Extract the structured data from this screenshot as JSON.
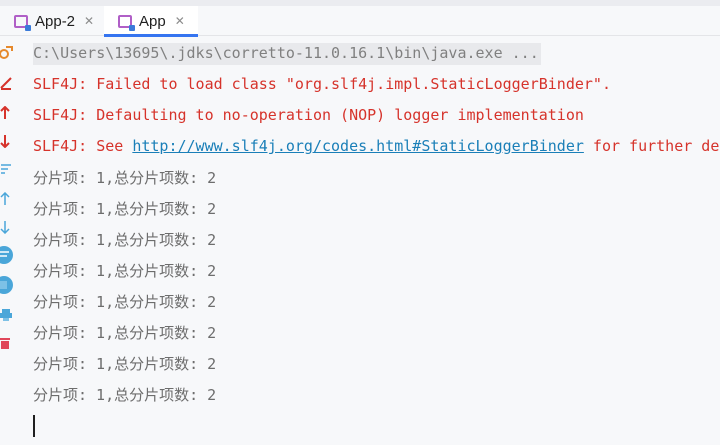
{
  "tabs": [
    {
      "label": "App-2",
      "close": "✕",
      "active": false
    },
    {
      "label": "App",
      "close": "✕",
      "active": true
    }
  ],
  "toolbar": {
    "icons": [
      "rerun-icon",
      "stop-icon",
      "scroll-up-icon",
      "scroll-down-icon",
      "soft-wrap-icon",
      "up-arrow-icon",
      "down-arrow-icon",
      "wrap-toggle-icon",
      "settings-icon",
      "print-icon",
      "delete-icon"
    ]
  },
  "console": {
    "command": "C:\\Users\\13695\\.jdks\\corretto-11.0.16.1\\bin\\java.exe ...",
    "errors": [
      {
        "text": "SLF4J: Failed to load class \"org.slf4j.impl.StaticLoggerBinder\"."
      },
      {
        "text": "SLF4J: Defaulting to no-operation (NOP) logger implementation"
      },
      {
        "prefix": "SLF4J: See ",
        "link": "http://www.slf4j.org/codes.html#StaticLoggerBinder",
        "suffix": " for further details."
      }
    ],
    "output": [
      "分片项: 1,总分片项数: 2",
      "分片项: 1,总分片项数: 2",
      "分片项: 1,总分片项数: 2",
      "分片项: 1,总分片项数: 2",
      "分片项: 1,总分片项数: 2",
      "分片项: 1,总分片项数: 2",
      "分片项: 1,总分片项数: 2",
      "分片项: 1,总分片项数: 2"
    ]
  },
  "colors": {
    "error": "#d6332b",
    "link": "#1a7fb8",
    "output": "#6d6d6d",
    "tab_underline": "#3574f0"
  }
}
